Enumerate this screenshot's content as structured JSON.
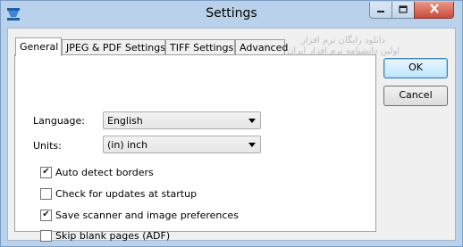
{
  "window": {
    "title": "Settings",
    "controls": {
      "minimize_icon": "minimize-icon",
      "maximize_icon": "maximize-icon",
      "close_icon": "close-icon"
    }
  },
  "tabs": [
    {
      "label": "General",
      "active": true
    },
    {
      "label": "JPEG & PDF Settings",
      "active": false
    },
    {
      "label": "TIFF Settings",
      "active": false
    },
    {
      "label": "Advanced",
      "active": false
    }
  ],
  "general": {
    "language_label": "Language:",
    "language_value": "English",
    "units_label": "Units:",
    "units_value": "(in) inch",
    "checkboxes": [
      {
        "label": "Auto detect borders",
        "checked": true
      },
      {
        "label": "Check for updates at startup",
        "checked": false
      },
      {
        "label": "Save scanner and image preferences",
        "checked": true
      },
      {
        "label": "Skip blank pages (ADF)",
        "checked": false
      }
    ]
  },
  "buttons": {
    "ok": "OK",
    "cancel": "Cancel"
  },
  "watermark": {
    "line1": "دانلود رایگان نرم افزار",
    "line2": "اولین دانشنامه نرم افزار ایران"
  },
  "colors": {
    "titlebar": "#b9d1ea",
    "close_button": "#c74c3c",
    "panel": "#ffffff"
  }
}
